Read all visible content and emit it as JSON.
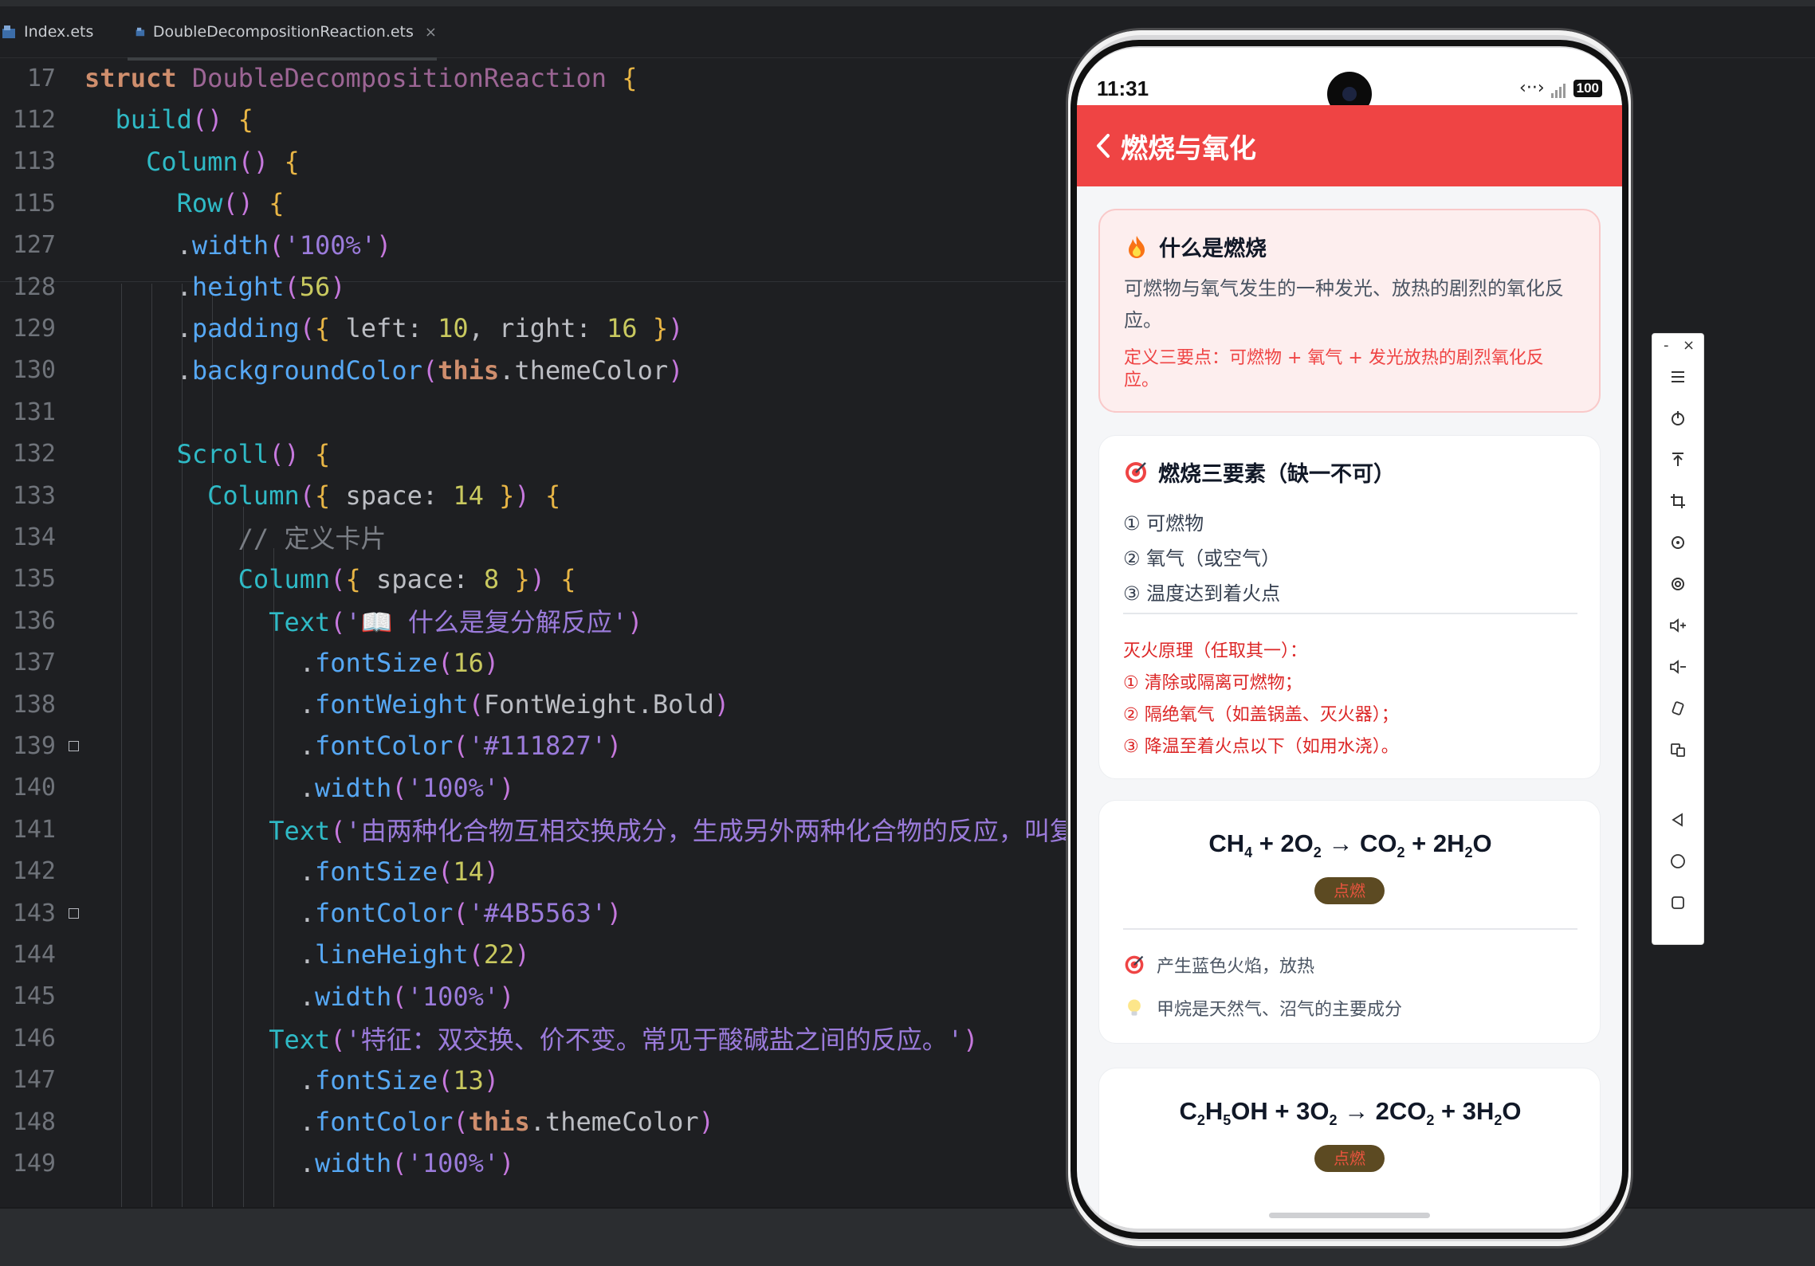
{
  "ide": {
    "tabs": [
      {
        "label": "Index.ets",
        "active": false
      },
      {
        "label": "DoubleDecompositionReaction.ets",
        "active": true,
        "close": "×"
      }
    ],
    "lines": [
      {
        "num": "17",
        "code": "struct DoubleDecompositionReaction {"
      },
      {
        "num": "112",
        "code": "  build() {"
      },
      {
        "num": "113",
        "code": "    Column() {"
      },
      {
        "num": "115",
        "code": "      Row() {"
      },
      {
        "num": "127",
        "code": "      .width('100%')"
      },
      {
        "num": "128",
        "code": "      .height(56)"
      },
      {
        "num": "129",
        "code": "      .padding({ left: 10, right: 16 })"
      },
      {
        "num": "130",
        "code": "      .backgroundColor(this.themeColor)"
      },
      {
        "num": "131",
        "code": ""
      },
      {
        "num": "132",
        "code": "      Scroll() {"
      },
      {
        "num": "133",
        "code": "        Column({ space: 14 }) {"
      },
      {
        "num": "134",
        "code": "          // 定义卡片"
      },
      {
        "num": "135",
        "code": "          Column({ space: 8 }) {"
      },
      {
        "num": "136",
        "code": "            Text('📖 什么是复分解反应')"
      },
      {
        "num": "137",
        "code": "              .fontSize(16)"
      },
      {
        "num": "138",
        "code": "              .fontWeight(FontWeight.Bold)"
      },
      {
        "num": "139",
        "code": "              .fontColor('#111827')"
      },
      {
        "num": "140",
        "code": "              .width('100%')"
      },
      {
        "num": "141",
        "code": "            Text('由两种化合物互相交换成分，生成另外两种化合物的反应，叫复"
      },
      {
        "num": "142",
        "code": "              .fontSize(14)"
      },
      {
        "num": "143",
        "code": "              .fontColor('#4B5563')"
      },
      {
        "num": "144",
        "code": "              .lineHeight(22)"
      },
      {
        "num": "145",
        "code": "              .width('100%')"
      },
      {
        "num": "146",
        "code": "            Text('特征：双交换、价不变。常见于酸碱盐之间的反应。')"
      },
      {
        "num": "147",
        "code": "              .fontSize(13)"
      },
      {
        "num": "148",
        "code": "              .fontColor(this.themeColor)"
      },
      {
        "num": "149",
        "code": "              .width('100%')"
      }
    ]
  },
  "phone": {
    "time": "11:31",
    "battery": "100",
    "title": "燃烧与氧化",
    "theme_color": "#EF4444",
    "definition": {
      "title": "什么是燃烧",
      "icon": "fire-icon",
      "body": "可燃物与氧气发生的一种发光、放热的剧烈的氧化反应。",
      "note": "定义三要点：可燃物 + 氧气 + 发光放热的剧烈氧化反应。"
    },
    "elements": {
      "title": "燃烧三要素（缺一不可）",
      "icon": "target-icon",
      "items": [
        "① 可燃物",
        "② 氧气（或空气）",
        "③ 温度达到着火点"
      ],
      "fire_title": "灭火原理（任取其一）：",
      "fire_items": [
        "① 清除或隔离可燃物；",
        "② 隔绝氧气（如盖锅盖、灭火器）；",
        "③ 降温至着火点以下（如用水浇）。"
      ]
    },
    "reactions": [
      {
        "equation": "CH4 + 2O2 → CO2 + 2H2O",
        "condition": "点燃",
        "observation": "产生蓝色火焰，放热",
        "tip": "甲烷是天然气、沼气的主要成分"
      },
      {
        "equation": "C2H5OH + 3O2 → 2CO2 + 3H2O",
        "condition": "点燃"
      }
    ]
  },
  "toolbar": {
    "minimize": "-",
    "close": "×",
    "buttons": [
      "menu-icon",
      "power-icon",
      "pin-top-icon",
      "crop-icon",
      "rotate-icon",
      "screenshot-icon",
      "volume-up-icon",
      "volume-down-icon",
      "shake-icon",
      "multi-screen-icon",
      "back-icon",
      "home-icon",
      "recents-icon"
    ]
  }
}
